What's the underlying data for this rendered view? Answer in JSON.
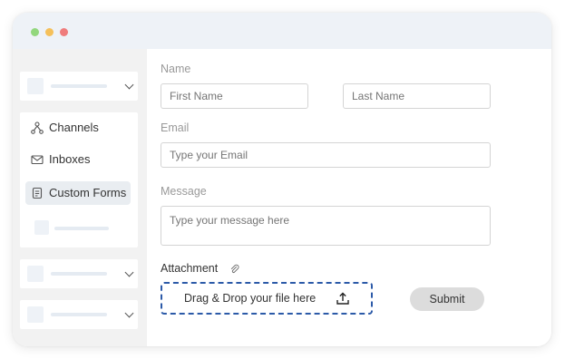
{
  "sidebar": {
    "nav_items": [
      {
        "label": "Channels",
        "icon": "channels-icon"
      },
      {
        "label": "Inboxes",
        "icon": "inbox-icon"
      },
      {
        "label": "Custom Forms",
        "icon": "form-icon",
        "active": true
      }
    ]
  },
  "form": {
    "name_label": "Name",
    "first_name_placeholder": "First Name",
    "last_name_placeholder": "Last Name",
    "email_label": "Email",
    "email_placeholder": "Type your Email",
    "message_label": "Message",
    "message_placeholder": "Type your message here",
    "attachment_label": "Attachment",
    "dropzone_text": "Drag & Drop your file here",
    "submit_label": "Submit"
  },
  "colors": {
    "dropzone_border": "#2c5aa8",
    "titlebar": "#eef2f7",
    "sidebar_bg": "#f2f2f2"
  }
}
